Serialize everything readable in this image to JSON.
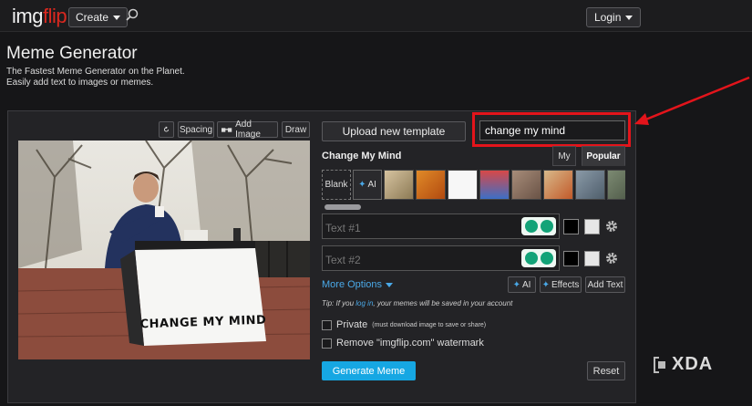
{
  "header": {
    "logo_part1": "img",
    "logo_part2": "flip",
    "create_label": "Create",
    "login_label": "Login",
    "search_icon": "magnifier-icon"
  },
  "main": {
    "title": "Meme Generator",
    "subtitle": "The Fastest Meme Generator on the Planet. Easily add text to images or memes."
  },
  "toolbar": {
    "rotate_icon": "rotate-icon",
    "spacing_label": "Spacing",
    "add_image_label": "Add Image",
    "draw_label": "Draw"
  },
  "meme": {
    "sign_text": "CHANGE MY MIND"
  },
  "editor": {
    "upload_label": "Upload new template",
    "search_value": "change my mind",
    "template_title": "Change My Mind",
    "tab_my": "My",
    "tab_popular": "Popular",
    "blank_label": "Blank",
    "ai_label": "AI",
    "text1_placeholder": "Text #1",
    "text2_placeholder": "Text #2",
    "more_options_label": "More Options",
    "ai_button_label": "AI",
    "effects_label": "Effects",
    "add_text_label": "Add Text",
    "tip_prefix": "Tip: If you ",
    "tip_link": "log in",
    "tip_suffix": ", your memes will be saved in your account",
    "private_label": "Private",
    "private_note": "(must download image to save or share)",
    "watermark_label": "Remove \"imgflip.com\" watermark",
    "generate_label": "Generate Meme",
    "reset_label": "Reset"
  },
  "overlay": {
    "watermark": "XDA",
    "highlight_color": "#e3141b"
  },
  "colors": {
    "accent": "#16a7e3",
    "link": "#4aa9e8",
    "brand_red": "#d9281f"
  }
}
